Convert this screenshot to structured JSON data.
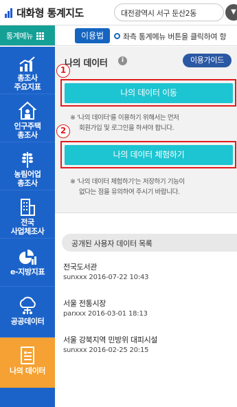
{
  "header": {
    "app_title": "대화형 통계지도",
    "region": "대전광역시 서구 둔산2동",
    "region_button_icon": "chevron-down-icon"
  },
  "menubar": {
    "menu_label": "통계메뉴",
    "usage_label": "이용법",
    "marquee_text": "좌측 통계메뉴 버튼을 클릭하여 항"
  },
  "sidebar": {
    "items": [
      {
        "label1": "총조사",
        "label2": "주요지표",
        "icon": "chart-icon"
      },
      {
        "label1": "인구주택",
        "label2": "총조사",
        "icon": "house-icon"
      },
      {
        "label1": "농림어업",
        "label2": "총조사",
        "icon": "grain-icon"
      },
      {
        "label1": "전국",
        "label2": "사업체조사",
        "icon": "building-icon"
      },
      {
        "label1": "e-지방지표",
        "label2": "",
        "icon": "pie-chart-icon"
      },
      {
        "label1": "공공데이터",
        "label2": "",
        "icon": "cloud-icon"
      },
      {
        "label1": "나의 데이터",
        "label2": "",
        "icon": "document-icon"
      }
    ],
    "active_index": 6
  },
  "content": {
    "title": "나의 데이터",
    "info_icon": "i",
    "guide_label": "이용가이드",
    "step1_num": "1",
    "step1_button": "나의 데이터 이동",
    "step1_note1": "※ '나의 데이터'를 이용하기 위해서는 먼저",
    "step1_note2": "회원가입 및 로그인을 하셔야 합니다.",
    "step2_num": "2",
    "step2_button": "나의 데이터 체험하기",
    "step2_note1": "※ '나의 데이터 체험하기'는 저장하기 기능이",
    "step2_note2": "없다는 점을 유의하여 주시기 바랍니다."
  },
  "public_list": {
    "header": "공개된 사용자 데이터 목록",
    "items": [
      {
        "title": "전국도서관",
        "meta": "sunxxx 2016-07-22 10:43"
      },
      {
        "title": "서울 전통시장",
        "meta": "parxxx 2016-03-01 18:13"
      },
      {
        "title": "서울 강북지역 민방위 대피시설",
        "meta": "sunxxx 2016-02-25 20:15"
      }
    ]
  },
  "colors": {
    "sidebar": "#1c63c9",
    "active": "#f5a133",
    "teal": "#1dc4d1",
    "highlight": "#e21a1a",
    "menu": "#15a096"
  }
}
